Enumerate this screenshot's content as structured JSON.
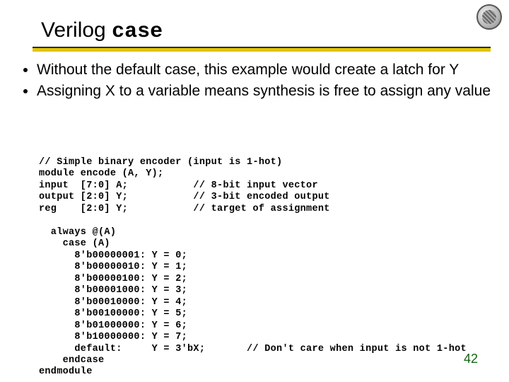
{
  "title": {
    "word1": "Verilog",
    "word2": "case"
  },
  "bullets": [
    "Without the default case, this example would create a latch for Y",
    "Assigning X to a variable means synthesis is free to assign any value"
  ],
  "code": "// Simple binary encoder (input is 1-hot)\nmodule encode (A, Y);\ninput  [7:0] A;           // 8-bit input vector\noutput [2:0] Y;           // 3-bit encoded output\nreg    [2:0] Y;           // target of assignment\n\n  always @(A)\n    case (A)\n      8'b00000001: Y = 0;\n      8'b00000010: Y = 1;\n      8'b00000100: Y = 2;\n      8'b00001000: Y = 3;\n      8'b00010000: Y = 4;\n      8'b00100000: Y = 5;\n      8'b01000000: Y = 6;\n      8'b10000000: Y = 7;\n      default:     Y = 3'bX;       // Don't care when input is not 1-hot\n    endcase\nendmodule",
  "pagenum": "42"
}
